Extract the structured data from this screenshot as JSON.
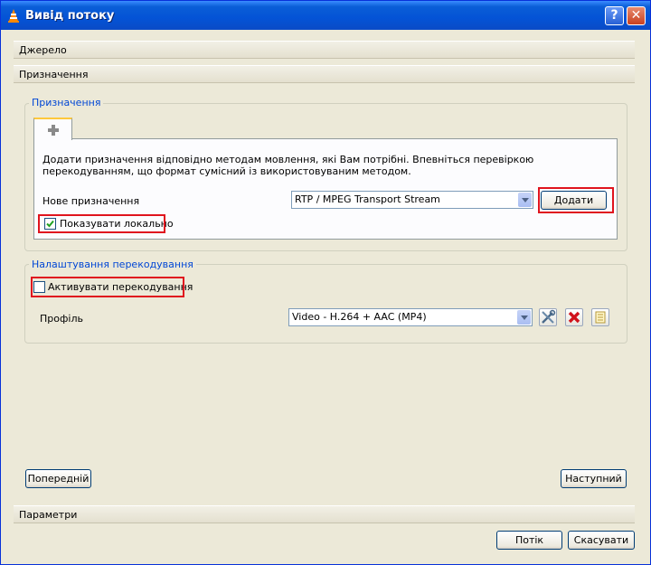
{
  "window": {
    "title": "Вивід потоку",
    "help_button": "?",
    "close_button": "✕"
  },
  "sections": {
    "source": "Джерело",
    "destination": "Призначення",
    "options": "Параметри"
  },
  "destination_group": {
    "title": "Призначення",
    "description": "Додати призначення відповідно методам мовлення, які Вам потрібні. Впевніться перевіркою перекодуванням, що формат сумісний із використовуваним методом.",
    "new_destination_label": "Нове призначення",
    "method_selected": "RTP / MPEG Transport Stream",
    "add_button": "Додати",
    "show_locally_label": "Показувати локально",
    "show_locally_checked": true
  },
  "transcode_group": {
    "title": "Налаштування перекодування",
    "activate_label": "Активувати перекодування",
    "activate_checked": false,
    "profile_label": "Профіль",
    "profile_selected": "Video - H.264 + AAC (MP4)"
  },
  "nav": {
    "prev_button": "Попередній",
    "next_button": "Наступний"
  },
  "footer": {
    "stream_button": "Потік",
    "cancel_button": "Скасувати"
  },
  "colors": {
    "highlight": "#e0141e",
    "group_title": "#0046d5",
    "titlebar": "#0a5ed7"
  }
}
